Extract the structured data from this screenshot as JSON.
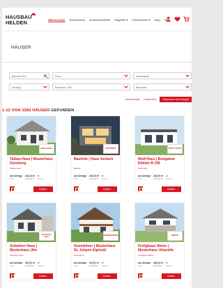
{
  "logo": {
    "line1": "HAUSBAU",
    "line2": "HELDEN"
  },
  "nav": {
    "items": [
      "Häusersuche",
      "Heldensuche",
      "Musterhausfinder",
      "Ratgeber ▾",
      "Traumhäuser ▾",
      "Shop",
      "Blog"
    ]
  },
  "page": {
    "title": "HÄUSER"
  },
  "filters": {
    "location": "Baustein PLZ",
    "price": "Preis",
    "living_area": "Wohnfläche",
    "house_type": "Haustyp",
    "construction": "Bauweise / Stil",
    "construction_method": "Bauweise",
    "reset_label": "Zurücksetzen",
    "search_label": "Detailsuche",
    "budget_label": "Hausname nach Budget"
  },
  "results": {
    "highlight": "1-12 VON 3283 HÄUSER",
    "rest": "GEFUNDEN"
  },
  "cards": [
    {
      "title": "Talbau Haus | Musterhaus Günzburg",
      "brand": "Talbau Haus",
      "price_label": "Auf Anfrage",
      "price_sub": "Preis",
      "area": "161,34 m²",
      "area_sub": "Wohnfläche",
      "rooms": "6",
      "rooms_sub": "Zimmer",
      "logo": "Talbau-Haus",
      "details": "Details ›"
    },
    {
      "title": "Bauhritz | Haus Gerlach",
      "brand": "Baufritz",
      "price_label": "Auf Anfrage",
      "price_sub": "Preis",
      "area": "230,53 m²",
      "area_sub": "Wohnfläche",
      "rooms": "6",
      "rooms_sub": "Zimmer",
      "logo": "BAUFRITZ",
      "details": "Details ›"
    },
    {
      "title": "Wolf-Haus | Bungalow Edition B 159",
      "brand": "Wolf Haus",
      "price_label": "Auf Anfrage",
      "price_sub": "Preis",
      "area": "218,00 m²",
      "area_sub": "Wohnfläche",
      "rooms": "4",
      "rooms_sub": "Zimmer",
      "logo": "WOLF HAUS",
      "details": "Details ›"
    },
    {
      "title": "Schwörer Haus | Musterhaus Ulm",
      "brand": "Schwörer Haus",
      "price_label": "Auf Anfrage",
      "price_sub": "Preis",
      "area": "161,00 m²",
      "area_sub": "Wohnfläche",
      "rooms": "5",
      "rooms_sub": "Zimmer",
      "logo": "Schwörer Haus",
      "details": "Details ›"
    },
    {
      "title": "Sonnleitner | Musterhaus St. Johann Alpinstil",
      "brand": "Sonnleitner",
      "price_label": "Auf Anfrage",
      "price_sub": "Preis",
      "area": "167,61 m²",
      "area_sub": "Wohnfläche",
      "rooms": "4",
      "rooms_sub": "Zimmer",
      "logo": "SONNLEITNER",
      "details": "Details ›"
    },
    {
      "title": "Fertighaus Weiss | Musterhaus Urbanlife",
      "brand": "Fertighaus Weiss",
      "price_label": "Auf Anfrage",
      "price_sub": "Preis",
      "area": "184,03 m²",
      "area_sub": "Wohnfläche",
      "rooms": "4",
      "rooms_sub": "Zimmer",
      "logo": "WEISS",
      "details": "Details ›"
    }
  ],
  "colors": {
    "accent": "#d6171f",
    "page": "#ffffff",
    "background": "#e9e9e9"
  },
  "icons": [
    "user-icon",
    "heart-icon",
    "cart-icon",
    "search-icon",
    "chevron-down-icon",
    "save-icon"
  ]
}
